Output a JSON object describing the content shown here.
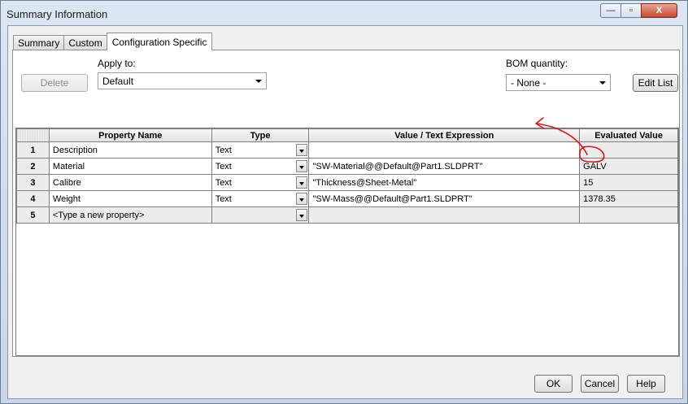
{
  "window": {
    "title": "Summary Information",
    "controls": {
      "minimize": "—",
      "maximize": "▫",
      "close": "X"
    }
  },
  "tabs": [
    {
      "label": "Summary"
    },
    {
      "label": "Custom"
    },
    {
      "label": "Configuration Specific",
      "active": true
    }
  ],
  "apply_to": {
    "label": "Apply to:",
    "value": "Default"
  },
  "bom": {
    "label": "BOM quantity:",
    "value": "- None -"
  },
  "buttons": {
    "delete": "Delete",
    "edit_list": "Edit List",
    "ok": "OK",
    "cancel": "Cancel",
    "help": "Help"
  },
  "table": {
    "headers": [
      "Property Name",
      "Type",
      "Value / Text Expression",
      "Evaluated Value"
    ],
    "rows": [
      {
        "num": "1",
        "name": "Description",
        "type": "Text",
        "value": "",
        "evaluated": ""
      },
      {
        "num": "2",
        "name": "Material",
        "type": "Text",
        "value": "\"SW-Material@@Default@Part1.SLDPRT\"",
        "evaluated": "GALV"
      },
      {
        "num": "3",
        "name": "Calibre",
        "type": "Text",
        "value": "\"Thickness@Sheet-Metal\"",
        "evaluated": "15"
      },
      {
        "num": "4",
        "name": "Weight",
        "type": "Text",
        "value": "\"SW-Mass@@Default@Part1.SLDPRT\"",
        "evaluated": "1378.35"
      },
      {
        "num": "5",
        "name": "<Type a new property>",
        "type": "",
        "value": "",
        "evaluated": ""
      }
    ]
  },
  "colors": {
    "annotation": "#d61a1a",
    "disabled_text": "#8a8a8a"
  }
}
